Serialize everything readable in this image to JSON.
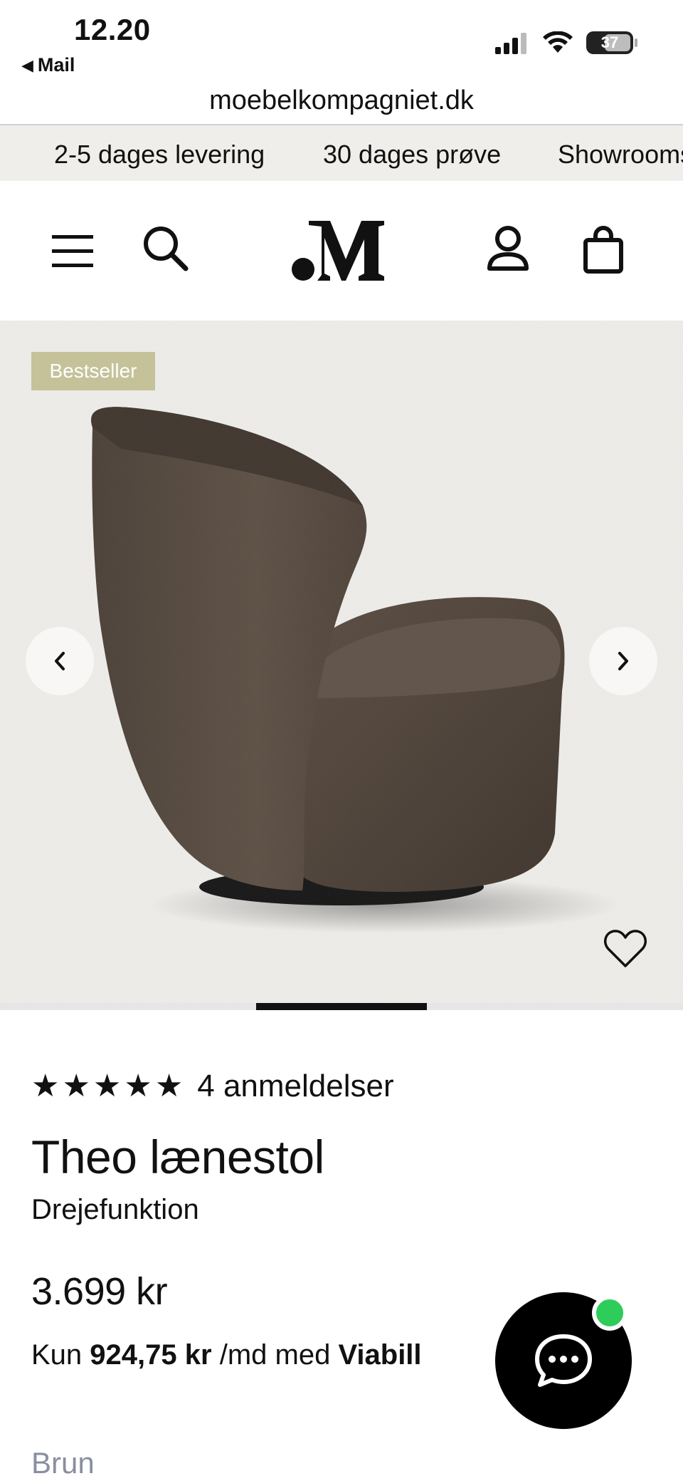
{
  "status_bar": {
    "time": "12.20",
    "back_app": "Mail",
    "battery": "37"
  },
  "browser": {
    "url": "moebelkompagniet.dk"
  },
  "usp": [
    "2-5 dages levering",
    "30 dages prøve",
    "Showrooms"
  ],
  "header": {
    "logo": "M"
  },
  "gallery": {
    "badge": "Bestseller",
    "progress_fraction": 0.25
  },
  "product": {
    "rating": 5,
    "reviews": "4 anmeldelser",
    "title": "Theo lænestol",
    "subtitle": "Drejefunktion",
    "price": "3.699 kr",
    "financing_prefix": "Kun",
    "financing_amount": "924,75 kr",
    "financing_mid": "/md med",
    "financing_provider": "Viabill",
    "color_label": "Brun"
  },
  "colors": {
    "badge": "#c5c29a",
    "gallery_bg": "#efedea",
    "chat_online": "#2ecc5a",
    "color_label": "#8a8fa0"
  }
}
